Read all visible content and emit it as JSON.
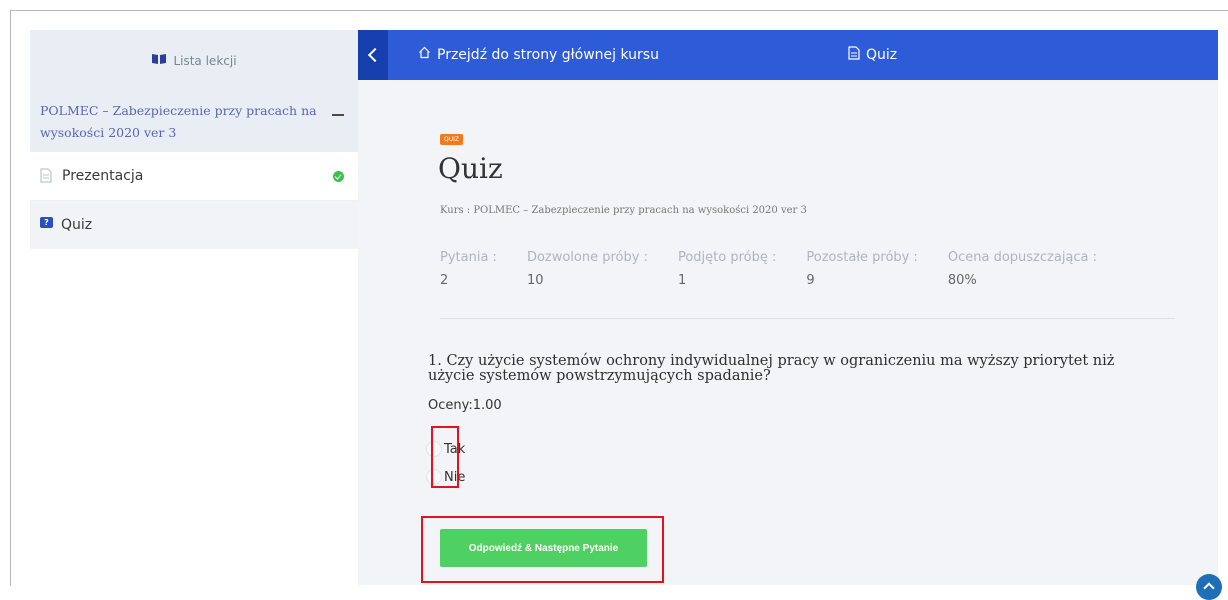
{
  "sidebar": {
    "header_label": "Lista lekcji",
    "course_title": "POLMEC – Zabezpieczenie przy pracach na wysokości 2020 ver 3",
    "items": [
      {
        "label": "Prezentacja",
        "completed": true
      },
      {
        "label": "Quiz",
        "completed": false
      }
    ]
  },
  "topbar": {
    "home_link": "Przejdź do strony głównej kursu",
    "current": "Quiz"
  },
  "quiz": {
    "tag": "QUIZ",
    "title": "Quiz",
    "course_line": "Kurs : POLMEC – Zabezpieczenie przy pracach na wysokości 2020 ver 3",
    "stats": [
      {
        "label": "Pytania :",
        "value": "2"
      },
      {
        "label": "Dozwolone próby :",
        "value": "10"
      },
      {
        "label": "Podjęto próbę :",
        "value": "1"
      },
      {
        "label": "Pozostałe próby :",
        "value": "9"
      },
      {
        "label": "Ocena dopuszczająca :",
        "value": "80%"
      }
    ],
    "question": "1. Czy użycie systemów ochrony indywidualnej pracy w ograniczeniu ma wyższy priorytet niż użycie systemów powstrzymujących spadanie?",
    "grade": "Oceny:1.00",
    "options": [
      "Tak",
      "Nie"
    ],
    "submit_label": "Odpowiedź & Następne Pytanie"
  },
  "colors": {
    "topbar": "#2e5bd8",
    "tag": "#f07a1c",
    "submit": "#4fd063",
    "highlight": "#e0141e"
  }
}
